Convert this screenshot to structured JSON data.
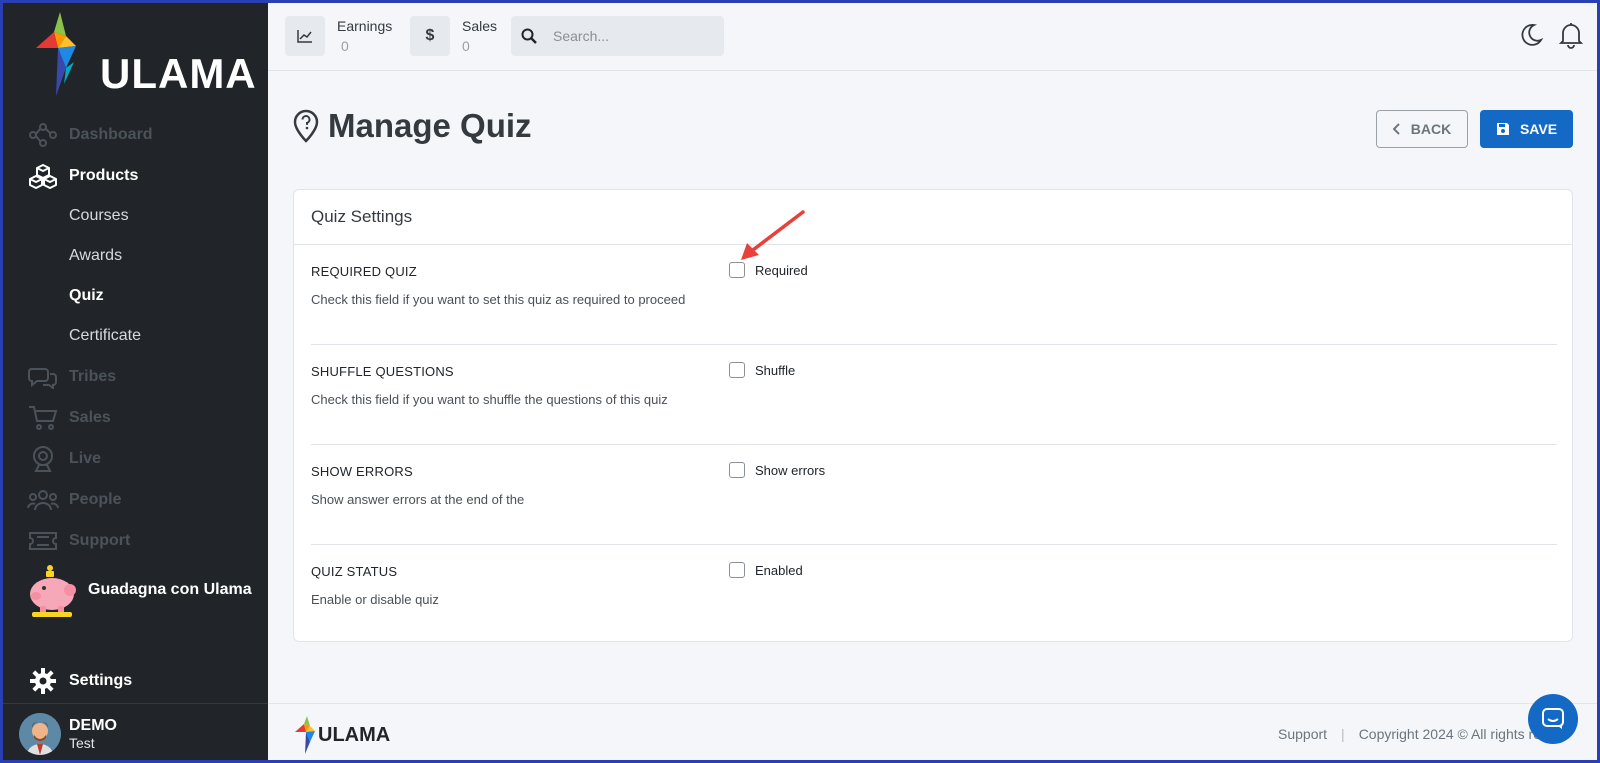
{
  "brand": {
    "name": "ULAMA"
  },
  "sidebar": {
    "items": [
      {
        "label": "Dashboard",
        "icon": "dashboard-nodes-icon"
      },
      {
        "label": "Products",
        "icon": "cubes-icon"
      },
      {
        "label": "Tribes",
        "icon": "chat-bubbles-icon"
      },
      {
        "label": "Sales",
        "icon": "cart-icon"
      },
      {
        "label": "Live",
        "icon": "webcam-icon"
      },
      {
        "label": "People",
        "icon": "people-icon"
      },
      {
        "label": "Support",
        "icon": "ticket-icon"
      }
    ],
    "subitems": [
      {
        "label": "Courses"
      },
      {
        "label": "Awards"
      },
      {
        "label": "Quiz"
      },
      {
        "label": "Certificate"
      }
    ],
    "promo": {
      "label": "Guadagna con Ulama",
      "icon": "piggy-bank-icon"
    },
    "settings": {
      "label": "Settings",
      "icon": "gear-icon"
    },
    "user": {
      "name": "DEMO",
      "role": "Test"
    }
  },
  "topbar": {
    "earnings": {
      "label": "Earnings",
      "value": "0",
      "icon": "chart-line-icon"
    },
    "sales": {
      "label": "Sales",
      "value": "0",
      "icon": "dollar-icon"
    },
    "search": {
      "placeholder": "Search..."
    }
  },
  "page": {
    "title": "Manage Quiz",
    "back_label": "BACK",
    "save_label": "SAVE"
  },
  "card": {
    "title": "Quiz Settings",
    "rows": [
      {
        "title": "REQUIRED QUIZ",
        "description": "Check this field if you want to set this quiz as required to proceed",
        "checkbox_label": "Required",
        "checked": false
      },
      {
        "title": "SHUFFLE QUESTIONS",
        "description": "Check this field if you want to shuffle the questions of this quiz",
        "checkbox_label": "Shuffle",
        "checked": false
      },
      {
        "title": "SHOW ERRORS",
        "description": "Show answer errors at the end of the",
        "checkbox_label": "Show errors",
        "checked": false
      },
      {
        "title": "QUIZ STATUS",
        "description": "Enable or disable quiz",
        "checkbox_label": "Enabled",
        "checked": false
      }
    ]
  },
  "footer": {
    "support_label": "Support",
    "separator": "|",
    "copyright": "Copyright 2024 © All rights res"
  },
  "colors": {
    "sidebar_bg": "#212529",
    "primary": "#1469c4",
    "annotation_arrow": "#e8403a"
  }
}
